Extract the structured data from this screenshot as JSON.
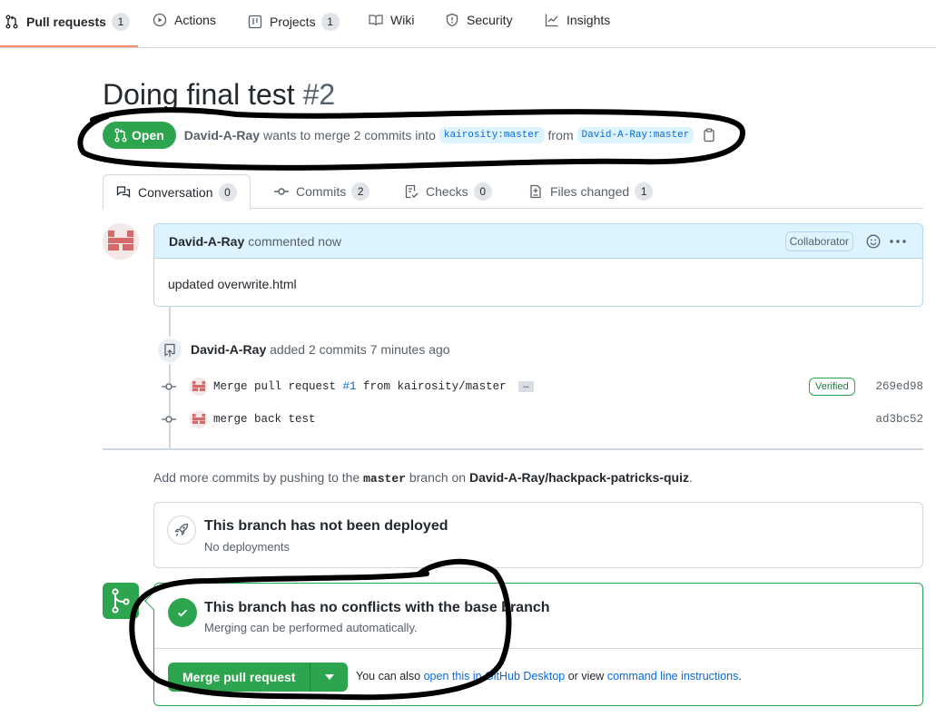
{
  "repo_nav": {
    "items": [
      {
        "label": "Pull requests",
        "count": "1",
        "icon": "git-pull-request-icon",
        "selected": true
      },
      {
        "label": "Actions",
        "icon": "play-icon"
      },
      {
        "label": "Projects",
        "count": "1",
        "icon": "table-icon"
      },
      {
        "label": "Wiki",
        "icon": "book-icon"
      },
      {
        "label": "Security",
        "icon": "shield-icon"
      },
      {
        "label": "Insights",
        "icon": "graph-icon"
      }
    ]
  },
  "pr": {
    "title": "Doing final test",
    "number": "#2",
    "state": "Open",
    "author": "David-A-Ray",
    "merge_text": "wants to merge 2 commits into",
    "base_branch": "kairosity:master",
    "from_text": "from",
    "head_branch": "David-A-Ray:master"
  },
  "tabs": [
    {
      "label": "Conversation",
      "count": "0",
      "icon": "comment-discussion-icon"
    },
    {
      "label": "Commits",
      "count": "2",
      "icon": "git-commit-icon"
    },
    {
      "label": "Checks",
      "count": "0",
      "icon": "checklist-icon"
    },
    {
      "label": "Files changed",
      "count": "1",
      "icon": "file-diff-icon"
    }
  ],
  "comment": {
    "author": "David-A-Ray",
    "action": "commented now",
    "role": "Collaborator",
    "body": "updated overwrite.html"
  },
  "push_event": {
    "author": "David-A-Ray",
    "text": "added 2 commits 7 minutes ago"
  },
  "commits": [
    {
      "msg_before": "Merge pull request ",
      "link": "#1",
      "msg_after": " from kairosity/master",
      "ellipsis": "…",
      "verified": "Verified",
      "sha": "269ed98"
    },
    {
      "msg_before": "merge back test",
      "link": "",
      "msg_after": "",
      "sha": "ad3bc52"
    }
  ],
  "hint": {
    "prefix": "Add more commits by pushing to the",
    "branch": "master",
    "middle": "branch on",
    "repo": "David-A-Ray/hackpack-patricks-quiz",
    "suffix": "."
  },
  "deploy": {
    "title": "This branch has not been deployed",
    "subtitle": "No deployments"
  },
  "merge": {
    "title": "This branch has no conflicts with the base branch",
    "subtitle": "Merging can be performed automatically.",
    "button": "Merge pull request",
    "also_prefix": "You can also",
    "desktop_link": "open this in GitHub Desktop",
    "or_view": "or view",
    "cli_link": "command line instructions",
    "period": "."
  },
  "colors": {
    "open_green": "#2da44e",
    "link_blue": "#0969da",
    "tab_underline": "#fd8c73",
    "annotation_ink": "#000000"
  }
}
